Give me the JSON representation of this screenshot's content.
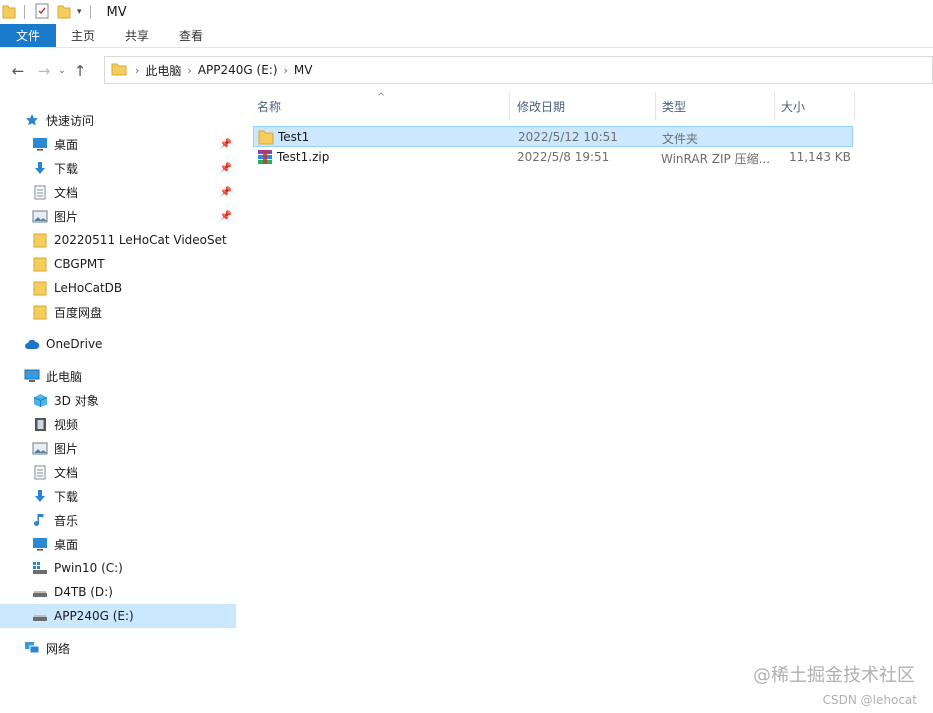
{
  "window": {
    "title": "MV"
  },
  "ribbon": {
    "tabs": [
      "文件",
      "主页",
      "共享",
      "查看"
    ]
  },
  "address": {
    "crumbs": [
      "此电脑",
      "APP240G (E:)",
      "MV"
    ]
  },
  "sidebar": {
    "quick_access": "快速访问",
    "pinned": [
      "桌面",
      "下载",
      "文档",
      "图片"
    ],
    "recent": [
      "20220511 LeHoCat VideoSet",
      "CBGPMT",
      "LeHoCatDB",
      "百度网盘"
    ],
    "onedrive": "OneDrive",
    "this_pc": "此电脑",
    "pc_items": [
      "3D 对象",
      "视频",
      "图片",
      "文档",
      "下载",
      "音乐",
      "桌面",
      "Pwin10 (C:)",
      "D4TB (D:)",
      "APP240G (E:)"
    ],
    "network": "网络"
  },
  "columns": {
    "name": "名称",
    "modified": "修改日期",
    "type": "类型",
    "size": "大小"
  },
  "files": [
    {
      "name": "Test1",
      "modified": "2022/5/12 10:51",
      "type": "文件夹",
      "size": "",
      "icon": "folder-icon"
    },
    {
      "name": "Test1.zip",
      "modified": "2022/5/8 19:51",
      "type": "WinRAR ZIP 压缩...",
      "size": "11,143 KB",
      "icon": "winrar-icon"
    }
  ],
  "watermark": {
    "line1": "@稀土掘金技术社区",
    "line2": "CSDN @lehocat"
  },
  "colors": {
    "accent": "#1979ca",
    "selection": "#cce8ff",
    "folder": "#f4cd5c"
  }
}
